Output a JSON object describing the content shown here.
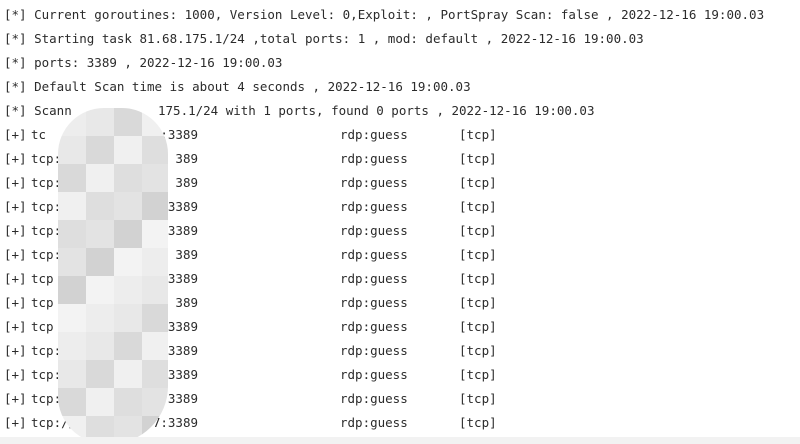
{
  "console": {
    "info_lines": [
      "[*] Current goroutines: 1000, Version Level: 0,Exploit: , PortSpray Scan: false , 2022-12-16 19:00.03",
      "[*] Starting task 81.68.175.1/24 ,total ports: 1 , mod: default , 2022-12-16 19:00.03",
      "[*] ports: 3389 , 2022-12-16 19:00.03",
      "[*] Default Scan time is about 4 seconds , 2022-12-16 19:00.03",
      "[*] Scann",
      "175.1/24 with 1 ports, found 0 ports , 2022-12-16 19:00.03"
    ],
    "results": [
      {
        "prefix": "[+]",
        "addr_start": "tc",
        "addr_end": ":3389",
        "service": "rdp:guess",
        "proto": "[tcp]"
      },
      {
        "prefix": "[+]",
        "addr_start": "tcp:",
        "addr_end": "389",
        "service": "rdp:guess",
        "proto": "[tcp]"
      },
      {
        "prefix": "[+]",
        "addr_start": "tcp:/",
        "addr_end": "389",
        "service": "rdp:guess",
        "proto": "[tcp]"
      },
      {
        "prefix": "[+]",
        "addr_start": "tcp:/",
        "addr_end": "3389",
        "service": "rdp:guess",
        "proto": "[tcp]"
      },
      {
        "prefix": "[+]",
        "addr_start": "tcp:",
        "addr_end": ":3389",
        "service": "rdp:guess",
        "proto": "[tcp]"
      },
      {
        "prefix": "[+]",
        "addr_start": "tcp:",
        "addr_end": "389",
        "service": "rdp:guess",
        "proto": "[tcp]"
      },
      {
        "prefix": "[+]",
        "addr_start": "tcp",
        "addr_end": "3389",
        "service": "rdp:guess",
        "proto": "[tcp]"
      },
      {
        "prefix": "[+]",
        "addr_start": "tcp",
        "addr_end": "389",
        "service": "rdp:guess",
        "proto": "[tcp]"
      },
      {
        "prefix": "[+]",
        "addr_start": "tcp",
        "addr_end": ":3389",
        "service": "rdp:guess",
        "proto": "[tcp]"
      },
      {
        "prefix": "[+]",
        "addr_start": "tcp:/",
        "addr_end": ":3389",
        "service": "rdp:guess",
        "proto": "[tcp]"
      },
      {
        "prefix": "[+]",
        "addr_start": "tcp:/",
        "addr_end": ":3389",
        "service": "rdp:guess",
        "proto": "[tcp]"
      },
      {
        "prefix": "[+]",
        "addr_start": "tcp:/",
        "addr_end": ":3389",
        "service": "rdp:guess",
        "proto": "[tcp]"
      },
      {
        "prefix": "[+]",
        "addr_start": "tcp://",
        "addr_end": "7:3389",
        "service": "rdp:guess",
        "proto": "[tcp]"
      }
    ]
  },
  "colors": {
    "text": "#2b2b2b",
    "background": "#ffffff",
    "redaction_light": "#ececec",
    "redaction_dark": "#d4d4d4"
  }
}
